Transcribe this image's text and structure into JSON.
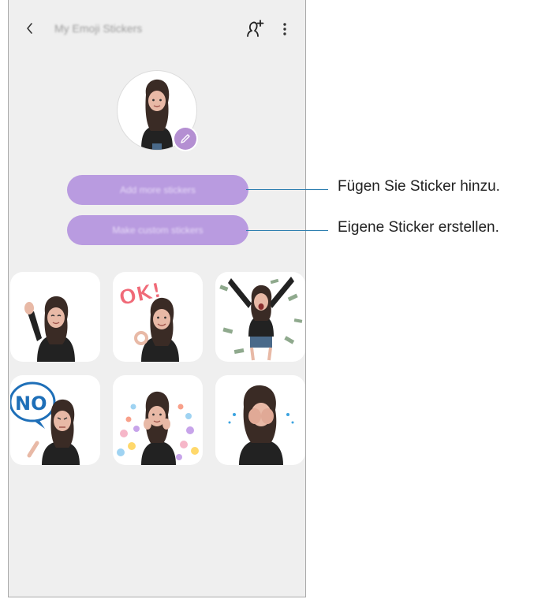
{
  "header": {
    "back_icon": "chevron-left-icon",
    "title": "My Emoji Stickers",
    "add_person_icon": "add-person-icon",
    "more_icon": "more-vertical-icon"
  },
  "avatar": {
    "edit_icon": "pencil-icon"
  },
  "buttons": {
    "add_more": "Add more stickers",
    "make_custom": "Make custom stickers"
  },
  "stickers": [
    {
      "name": "wave"
    },
    {
      "name": "ok",
      "text": "OK!"
    },
    {
      "name": "money-rain"
    },
    {
      "name": "no",
      "text": "NO"
    },
    {
      "name": "hearts"
    },
    {
      "name": "crying"
    }
  ],
  "callouts": [
    "Fügen Sie Sticker hinzu.",
    "Eigene Sticker erstellen."
  ],
  "colors": {
    "accent_purple": "#b99be0",
    "callout_line": "#2e7fb0",
    "screen_bg": "#efefef"
  }
}
